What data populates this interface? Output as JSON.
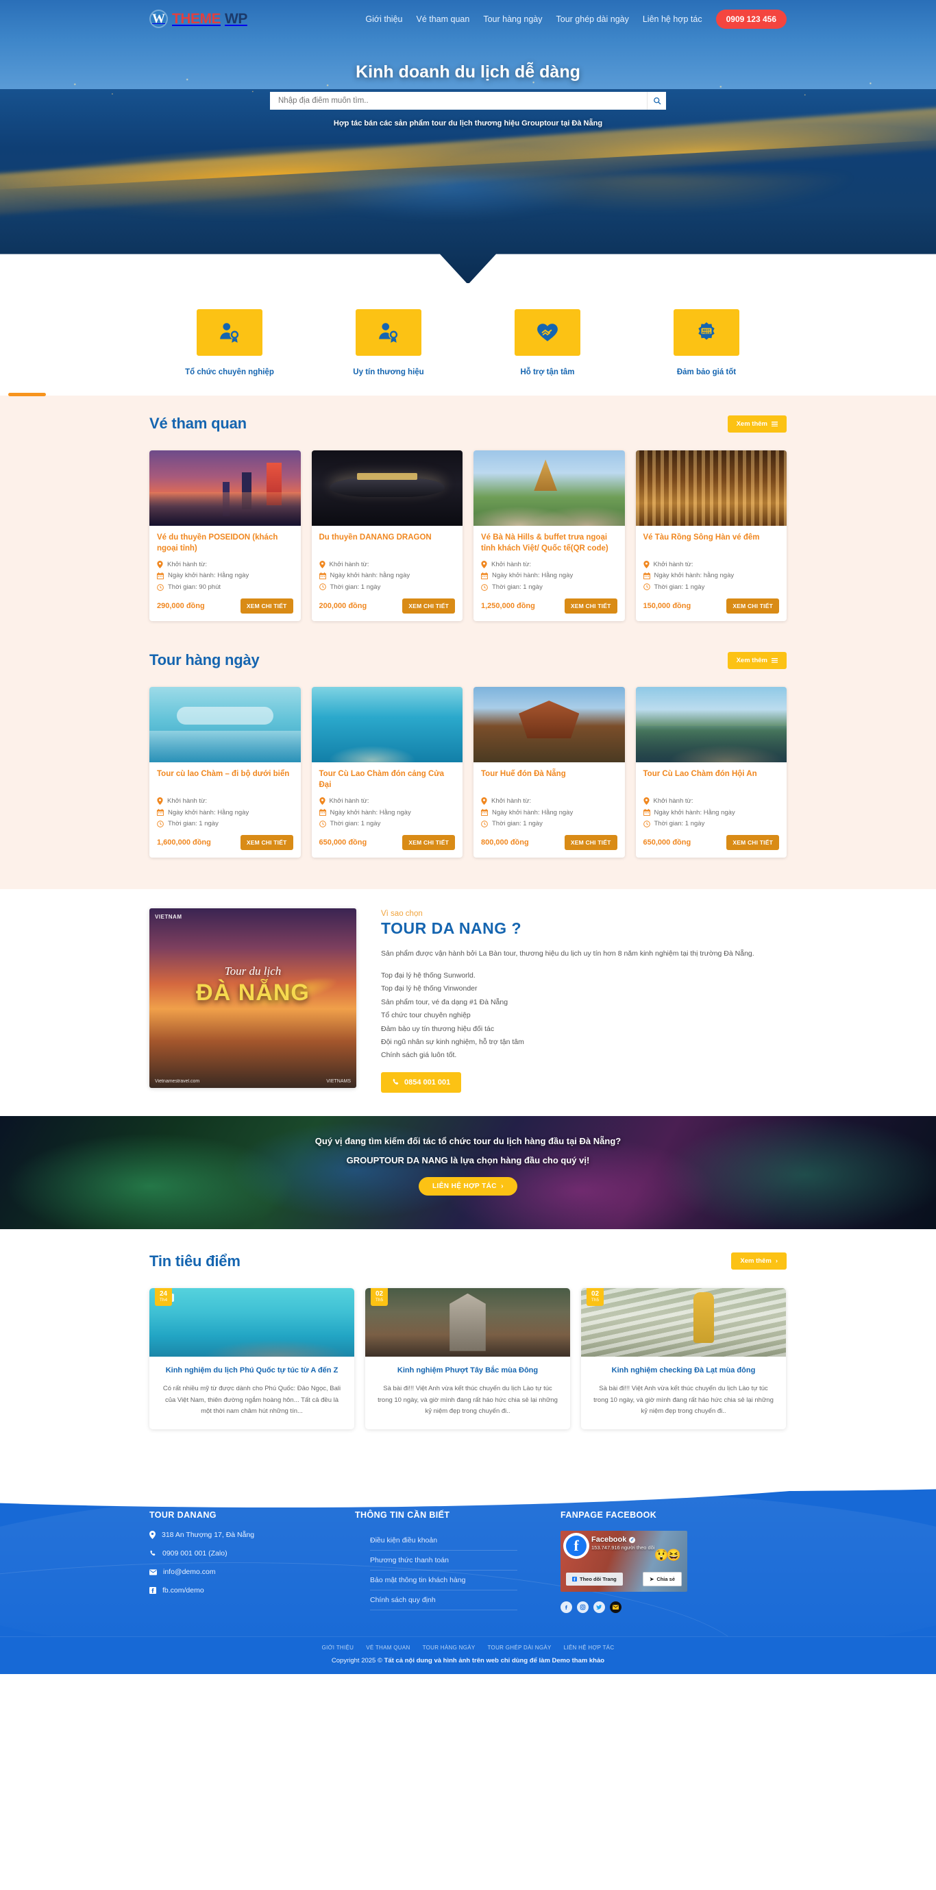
{
  "header": {
    "logo": {
      "part1": "THEME",
      "part2": "WP",
      "icon": "wordpress-icon"
    },
    "nav": [
      {
        "label": "Giới thiệu"
      },
      {
        "label": "Vé tham quan"
      },
      {
        "label": "Tour hàng ngày"
      },
      {
        "label": "Tour ghép dài ngày"
      },
      {
        "label": "Liên hệ hợp tác"
      }
    ],
    "phone": "0909 123 456"
  },
  "hero": {
    "title": "Kinh doanh du lịch dễ dàng",
    "search_placeholder": "Nhập địa điểm muốn tìm..",
    "search_value": "",
    "search_icon": "search-icon",
    "subtitle": "Hợp tác bán các sản phẩm tour du lịch thương hiệu Grouptour tại Đà Nẵng"
  },
  "features": [
    {
      "label": "Tổ chức chuyên nghiệp",
      "icon": "user-badge-icon"
    },
    {
      "label": "Uy tín thương hiệu",
      "icon": "user-award-icon"
    },
    {
      "label": "Hỗ trợ tận tâm",
      "icon": "handshake-heart-icon"
    },
    {
      "label": "Đảm bảo giá tốt",
      "icon": "best-price-icon"
    }
  ],
  "tickets_section": {
    "title": "Vé tham quan",
    "more_label": "Xem thêm",
    "cards": [
      {
        "title": "Vé du thuyền POSEIDON (khách ngoại tỉnh)",
        "depart_label": "Khởi hành từ:",
        "date_label": "Ngày khởi hành: Hằng ngày",
        "duration_label": "Thời gian: 90 phút",
        "price": "290,000 đồng",
        "button": "XEM CHI TIẾT",
        "image": "poseidon-cruise-night-city"
      },
      {
        "title": "Du thuyền DANANG DRAGON",
        "depart_label": "Khởi hành từ:",
        "date_label": "Ngày khởi hành: hằng ngày",
        "duration_label": "Thời gian: 1 ngày",
        "price": "200,000 đồng",
        "button": "XEM CHI TIẾT",
        "image": "danang-dragon-boat"
      },
      {
        "title": "Vé Bà Nà Hills & buffet trưa ngoại tỉnh khách Việt/ Quốc tế(QR code)",
        "depart_label": "Khởi hành từ:",
        "date_label": "Ngày khởi hành: Hằng ngày",
        "duration_label": "Thời gian: 1 ngày",
        "price": "1,250,000 đồng",
        "button": "XEM CHI TIẾT",
        "image": "bana-hills-french-village"
      },
      {
        "title": "Vé Tàu Rồng Sông Hàn vé đêm",
        "depart_label": "Khởi hành từ:",
        "date_label": "Ngày khởi hành: hằng ngày",
        "duration_label": "Thời gian: 1 ngày",
        "price": "150,000 đồng",
        "button": "XEM CHI TIẾT",
        "image": "dragon-boat-interior-lights"
      }
    ]
  },
  "tours_section": {
    "title": "Tour hàng ngày",
    "more_label": "Xem thêm",
    "cards": [
      {
        "title": "Tour cù lao Chàm – đi bộ dưới biển",
        "depart_label": "Khởi hành từ:",
        "date_label": "Ngày khởi hành: Hằng ngày",
        "duration_label": "Thời gian: 1 ngày",
        "price": "1,600,000 đồng",
        "button": "XEM CHI TIẾT",
        "image": "sea-walking-cham-island"
      },
      {
        "title": "Tour Cù Lao Chàm đón cảng Cửa Đại",
        "depart_label": "Khởi hành từ:",
        "date_label": "Ngày khởi hành: Hằng ngày",
        "duration_label": "Thời gian: 1 ngày",
        "price": "650,000 đồng",
        "button": "XEM CHI TIẾT",
        "image": "snorkeling-turquoise-sea"
      },
      {
        "title": "Tour Huế đón Đà Nẵng",
        "depart_label": "Khởi hành từ:",
        "date_label": "Ngày khởi hành: Hằng ngày",
        "duration_label": "Thời gian: 1 ngày",
        "price": "800,000 đồng",
        "button": "XEM CHI TIẾT",
        "image": "hue-imperial-temple"
      },
      {
        "title": "Tour Cù Lao Chàm đón Hội An",
        "depart_label": "Khởi hành từ:",
        "date_label": "Ngày khởi hành: Hằng ngày",
        "duration_label": "Thời gian: 1 ngày",
        "price": "650,000 đồng",
        "button": "XEM CHI TIẾT",
        "image": "rocky-coastline-island"
      }
    ]
  },
  "why": {
    "image_brand": "VIETNAM",
    "image_script": "Tour du lịch",
    "image_title": "ĐÀ NẴNG",
    "image_footer_left": "Vietnamestravel.com",
    "image_footer_right": "VIETNAMS",
    "eyebrow": "Vì sao chọn",
    "heading": "TOUR DA NANG ?",
    "paragraph": "Sản phẩm được vận hành bởi La Bàn tour, thương hiệu du lịch uy tín hơn 8 năm kinh nghiệm tại thị trường Đà Nẵng.",
    "bullets": [
      "Top đại lý hệ thống Sunworld.",
      "Top đại lý hệ thống Vinwonder",
      "Sản phẩm tour, vé đa dạng #1 Đà Nẵng",
      "Tổ chức tour chuyên nghiệp",
      "Đảm bảo uy tín thương hiệu đối tác",
      "Đội ngũ nhân sự kinh nghiệm, hỗ trợ tận tâm",
      "Chính sách giá luôn tốt."
    ],
    "hotline": "0854 001 001",
    "hotline_icon": "phone-icon"
  },
  "cta": {
    "line1": "Quý vị đang tìm kiếm đối tác tổ chức tour du lịch hàng đầu tại Đà Nẵng?",
    "line2": "GROUPTOUR DA NANG là lựa chọn hàng đầu cho quý vị!",
    "button": "LIÊN HỆ HỢP TÁC"
  },
  "news_section": {
    "title": "Tin tiêu điểm",
    "more_label": "Xem thêm",
    "cards": [
      {
        "day": "24",
        "month": "Th4",
        "title": "Kinh nghiệm du lịch Phú Quốc tự túc từ A đến Z",
        "excerpt": "Có rất nhiều mỹ từ được dành cho Phú Quốc: Đảo Ngọc, Bali của Việt Nam, thiên đường ngắm hoàng hôn... Tất cả đều là một thời nam châm hút những tín...",
        "image": "phu-quoc-beach-boat"
      },
      {
        "day": "02",
        "month": "Th5",
        "title": "Kinh nghiệm Phượt Tây Bắc mùa Đông",
        "excerpt": "Sà bài đi!!! Việt Anh vừa kết thúc chuyến du lịch Lào tự túc trong 10 ngày, và giờ mình đang rất háo hức chia sẻ lại những kỷ niệm đẹp trong chuyến đi..",
        "image": "stone-church-northwest"
      },
      {
        "day": "02",
        "month": "Th5",
        "title": "Kinh nghiệm checking Đà Lạt mùa đông",
        "excerpt": "Sà bài đi!!! Việt Anh vừa kết thúc chuyến du lịch Lào tự túc trong 10 ngày, và giờ mình đang rất háo hức chia sẻ lại những kỷ niệm đẹp trong chuyến đi..",
        "image": "dalat-flower-field-girl"
      }
    ]
  },
  "footer": {
    "col1": {
      "heading": "TOUR DANANG",
      "address": "318 An Thượng 17, Đà Nẵng",
      "phone": "0909 001 001 (Zalo)",
      "email": "info@demo.com",
      "facebook": "fb.com/demo"
    },
    "col2": {
      "heading": "THÔNG TIN CẦN BIẾT",
      "links": [
        "Điều kiện điều khoản",
        "Phương thức thanh toán",
        "Bảo mật thông tin khách hàng",
        "Chính sách quy định"
      ]
    },
    "col3": {
      "heading": "FANPAGE FACEBOOK",
      "page_name": "Facebook",
      "followers": "153.747.916 người theo dõi",
      "follow_button": "Theo dõi Trang",
      "share_button": "Chia sẻ",
      "socials": [
        "facebook-icon",
        "instagram-icon",
        "twitter-icon",
        "mail-icon"
      ]
    },
    "bottom_nav": [
      "GIỚI THIỆU",
      "VÉ THAM QUAN",
      "TOUR HÀNG NGÀY",
      "TOUR GHÉP DÀI NGÀY",
      "LIÊN HỆ HỢP TÁC"
    ],
    "copyright_prefix": "Copyright 2025 © ",
    "copyright_strong": "Tất cả nội dung và hình ảnh trên web chỉ dùng để làm Demo tham khảo"
  },
  "colors": {
    "brand_blue": "#1565b0",
    "accent_yellow": "#fcc214",
    "accent_orange": "#f0871f",
    "phone_red": "#f4453f",
    "footer_blue": "#1769d6",
    "section_bg": "#fdf1ea"
  }
}
